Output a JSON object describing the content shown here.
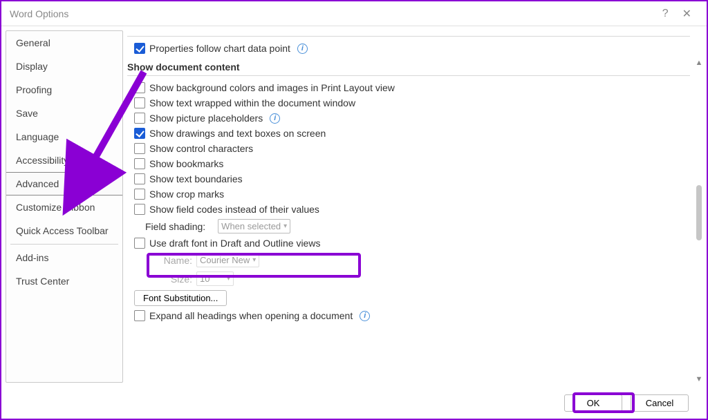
{
  "window": {
    "title": "Word Options"
  },
  "sidebar": {
    "items": [
      {
        "label": "General"
      },
      {
        "label": "Display"
      },
      {
        "label": "Proofing"
      },
      {
        "label": "Save"
      },
      {
        "label": "Language"
      },
      {
        "label": "Accessibility"
      },
      {
        "label": "Advanced",
        "selected": true
      },
      {
        "label": "Customize Ribbon"
      },
      {
        "label": "Quick Access Toolbar"
      },
      {
        "label": "Add-ins"
      },
      {
        "label": "Trust Center"
      }
    ]
  },
  "content": {
    "properties_follow": "Properties follow chart data point",
    "section_header": "Show document content",
    "opts": {
      "bg_colors": "Show background colors and images in Print Layout view",
      "text_wrapped": "Show text wrapped within the document window",
      "picture_placeholders": "Show picture placeholders",
      "drawings": "Show drawings and text boxes on screen",
      "control_chars": "Show control characters",
      "bookmarks": "Show bookmarks",
      "text_boundaries": "Show text boundaries",
      "crop_marks": "Show crop marks",
      "field_codes": "Show field codes instead of their values",
      "field_shading_label": "Field shading:",
      "field_shading_value": "When selected",
      "draft_font": "Use draft font in Draft and Outline views",
      "name_label": "Name:",
      "name_value": "Courier New",
      "size_label": "Size:",
      "size_value": "10",
      "font_sub": "Font Substitution...",
      "expand_headings": "Expand all headings when opening a document"
    }
  },
  "footer": {
    "ok": "OK",
    "cancel": "Cancel"
  }
}
